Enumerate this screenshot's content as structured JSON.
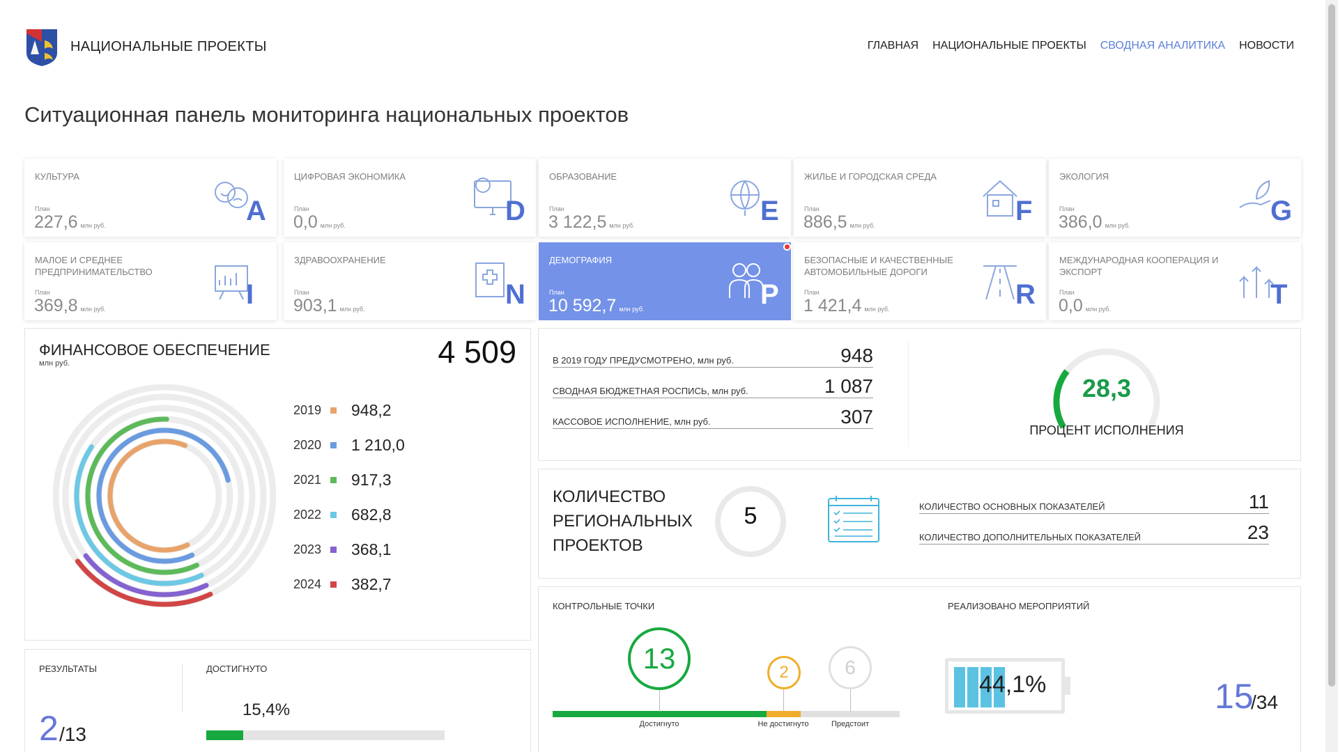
{
  "header": {
    "brand": "НАЦИОНАЛЬНЫЕ ПРОЕКТЫ",
    "nav": [
      {
        "label": "ГЛАВНАЯ",
        "active": false
      },
      {
        "label": "НАЦИОНАЛЬНЫЕ ПРОЕКТЫ",
        "active": false
      },
      {
        "label": "СВОДНАЯ АНАЛИТИКА",
        "active": true
      },
      {
        "label": "НОВОСТИ",
        "active": false
      }
    ]
  },
  "page_title": "Ситуационная панель мониторинга национальных проектов",
  "projects": [
    {
      "name": "КУЛЬТУРА",
      "plan_label": "План",
      "value": "227,6",
      "unit": "млн руб.",
      "letter": "A",
      "icon": "theater-masks-icon",
      "active": false
    },
    {
      "name": "ЦИФРОВАЯ ЭКОНОМИКА",
      "plan_label": "План",
      "value": "0,0",
      "unit": "млн руб.",
      "letter": "D",
      "icon": "computer-chart-icon",
      "active": false
    },
    {
      "name": "ОБРАЗОВАНИЕ",
      "plan_label": "План",
      "value": "3 122,5",
      "unit": "млн руб.",
      "letter": "E",
      "icon": "globe-icon",
      "active": false
    },
    {
      "name": "ЖИЛЬЕ И ГОРОДСКАЯ СРЕДА",
      "plan_label": "План",
      "value": "886,5",
      "unit": "млн руб.",
      "letter": "F",
      "icon": "house-icon",
      "active": false
    },
    {
      "name": "ЭКОЛОГИЯ",
      "plan_label": "План",
      "value": "386,0",
      "unit": "млн руб.",
      "letter": "G",
      "icon": "hand-leaf-icon",
      "active": false
    },
    {
      "name": "МАЛОЕ И СРЕДНЕЕ ПРЕДПРИНИМАТЕЛЬСТВО",
      "plan_label": "План",
      "value": "369,8",
      "unit": "млн руб.",
      "letter": "I",
      "icon": "presentation-board-icon",
      "active": false
    },
    {
      "name": "ЗДРАВООХРАНЕНИЕ",
      "plan_label": "План",
      "value": "903,1",
      "unit": "млн руб.",
      "letter": "N",
      "icon": "medical-record-icon",
      "active": false
    },
    {
      "name": "ДЕМОГРАФИЯ",
      "plan_label": "План",
      "value": "10 592,7",
      "unit": "млн руб.",
      "letter": "P",
      "icon": "family-icon",
      "active": true
    },
    {
      "name": "БЕЗОПАСНЫЕ И КАЧЕСТВЕННЫЕ АВТОМОБИЛЬНЫЕ ДОРОГИ",
      "plan_label": "План",
      "value": "1 421,4",
      "unit": "млн руб.",
      "letter": "R",
      "icon": "road-icon",
      "active": false
    },
    {
      "name": "МЕЖДУНАРОДНАЯ КООПЕРАЦИЯ И ЭКСПОРТ",
      "plan_label": "План",
      "value": "0,0",
      "unit": "млн руб.",
      "letter": "T",
      "icon": "export-arrows-icon",
      "active": false
    }
  ],
  "finance": {
    "title": "ФИНАНСОВОЕ ОБЕСПЕЧЕНИЕ",
    "unit": "млн руб.",
    "total": "4 509"
  },
  "chart_data": {
    "type": "radial-bar",
    "categories": [
      "2019",
      "2020",
      "2021",
      "2022",
      "2023",
      "2024"
    ],
    "values": [
      948.2,
      1210.0,
      917.3,
      682.8,
      368.1,
      382.7
    ],
    "labels": [
      "948,2",
      "1 210,0",
      "917,3",
      "682,8",
      "368,1",
      "382,7"
    ],
    "colors": [
      "#e8a36a",
      "#6a9be0",
      "#5cba5a",
      "#6cc8e4",
      "#8462d0",
      "#d14545"
    ],
    "title": "ФИНАНСОВОЕ ОБЕСПЕЧЕНИЕ",
    "unit": "млн руб.",
    "total": 4509
  },
  "results": {
    "label": "РЕЗУЛЬТАТЫ",
    "achieved_label": "ДОСТИГНУТО",
    "done": "2",
    "total": "/13",
    "percent": "15,4%",
    "percent_value": 15.4
  },
  "budget": {
    "rows": [
      {
        "label": "В 2019 ГОДУ ПРЕДУСМОТРЕНО,",
        "unit": "млн руб.",
        "value": "948"
      },
      {
        "label": "СВОДНАЯ БЮДЖЕТНАЯ РОСПИСЬ,",
        "unit": "млн руб.",
        "value": "1 087"
      },
      {
        "label": "КАССОВОЕ ИСПОЛНЕНИЕ,",
        "unit": "млн руб.",
        "value": "307"
      }
    ],
    "percent": "28,3",
    "percent_value": 28.3,
    "percent_label": "ПРОЦЕНТ ИСПОЛНЕНИЯ"
  },
  "regional": {
    "title": "КОЛИЧЕСТВО РЕГИОНАЛЬНЫХ ПРОЕКТОВ",
    "count": "5",
    "indicators": [
      {
        "label": "КОЛИЧЕСТВО ОСНОВНЫХ ПОКАЗАТЕЛЕЙ",
        "value": "11"
      },
      {
        "label": "КОЛИЧЕСТВО ДОПОЛНИТЕЛЬНЫХ ПОКАЗАТЕЛЕЙ",
        "value": "23"
      }
    ]
  },
  "checkpoints": {
    "title": "КОНТРОЛЬНЫЕ ТОЧКИ",
    "achieved": "13",
    "achieved_label": "Достигнуто",
    "not_achieved": "2",
    "not_achieved_label": "Не достигнуто",
    "upcoming": "6",
    "upcoming_label": "Предстоит",
    "colors": {
      "achieved": "#17a93f",
      "not_achieved": "#f0ad2b",
      "upcoming": "#cfcfcf"
    }
  },
  "events": {
    "title": "РЕАЛИЗОВАНО МЕРОПРИЯТИЙ",
    "percent": "44,1%",
    "percent_value": 44.1,
    "done": "15",
    "total": "/34"
  }
}
